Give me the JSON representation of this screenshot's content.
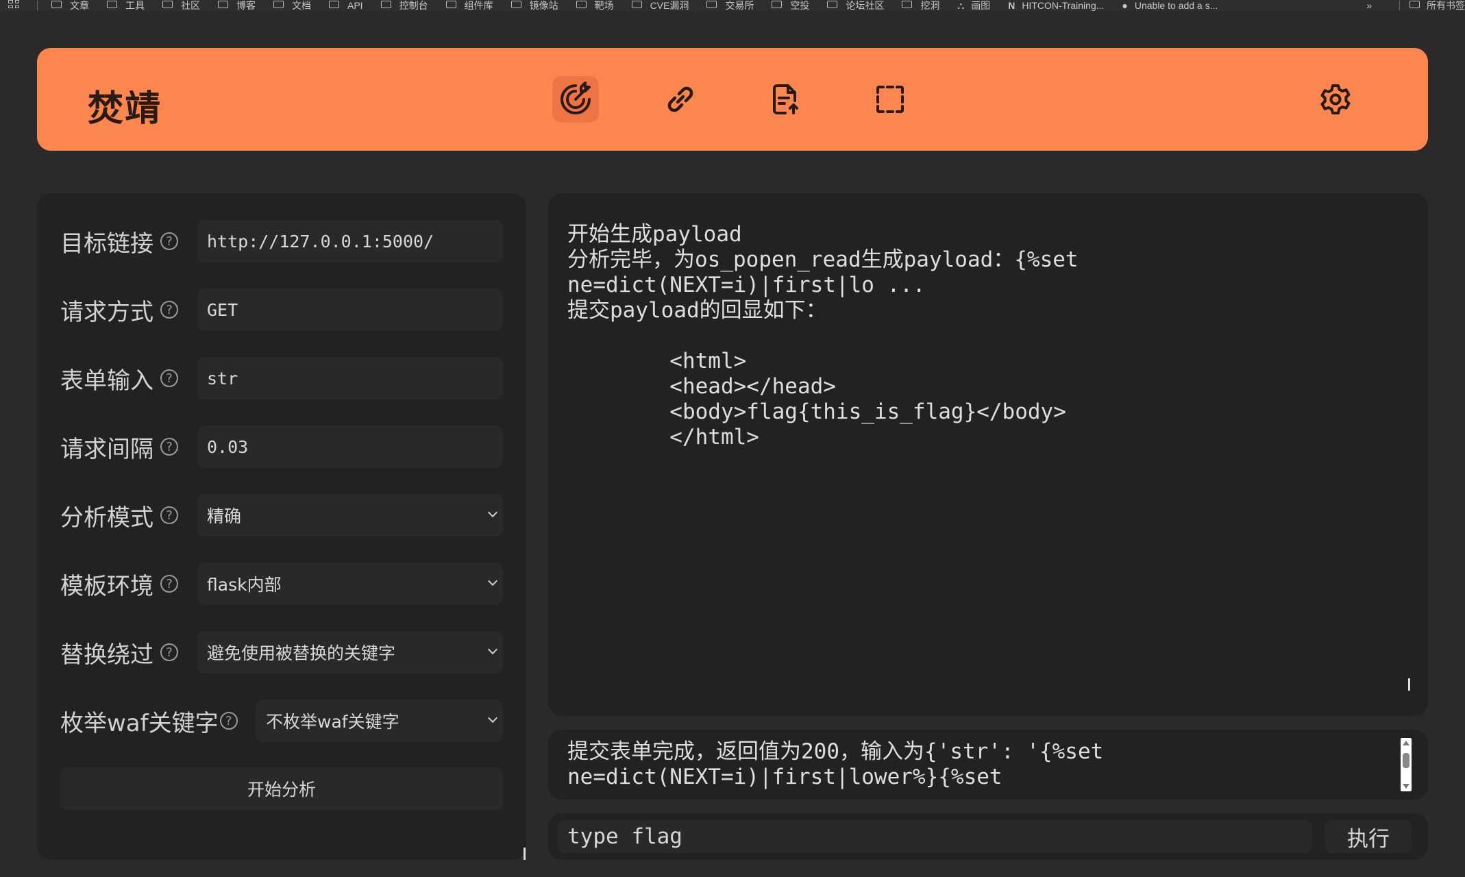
{
  "bookmarks": {
    "items": [
      "文章",
      "工具",
      "社区",
      "博客",
      "文档",
      "API",
      "控制台",
      "组件库",
      "镜像站",
      "靶场",
      "CVE漏洞",
      "交易所",
      "空投",
      "论坛社区",
      "挖洞",
      "画图",
      "HITCON-Training...",
      "Unable to add a s..."
    ],
    "more": "»",
    "all_bookmarks": "所有书签"
  },
  "header": {
    "title": "焚靖",
    "nav": [
      "crack-icon",
      "link-icon",
      "upload-file-icon",
      "scan-icon"
    ],
    "settings": "gear-icon"
  },
  "form": {
    "fields": [
      {
        "label": "目标链接",
        "value": "http://127.0.0.1:5000/"
      },
      {
        "label": "请求方式",
        "value": "GET"
      },
      {
        "label": "表单输入",
        "value": "str"
      },
      {
        "label": "请求间隔",
        "value": "0.03"
      },
      {
        "label": "分析模式",
        "value": "精确"
      },
      {
        "label": "模板环境",
        "value": "flask内部"
      },
      {
        "label": "替换绕过",
        "value": "避免使用被替换的关键字"
      },
      {
        "label": "枚举waf关键字",
        "value": "不枚举waf关键字"
      }
    ],
    "help_glyph": "?",
    "start_button": "开始分析"
  },
  "output": {
    "text": "开始生成payload\n分析完毕，为os_popen_read生成payload：{%set\nne=dict(NEXT=i)|first|lo ...\n提交payload的回显如下：\n\n        <html>\n        <head></head>\n        <body>flag{this_is_flag}</body>\n        </html>"
  },
  "status": {
    "text": "提交表单完成，返回值为200，输入为{'str': '{%set\nne=dict(NEXT=i)|first|lower%}{%set"
  },
  "command": {
    "value": "type flag",
    "execute_button": "执行"
  }
}
